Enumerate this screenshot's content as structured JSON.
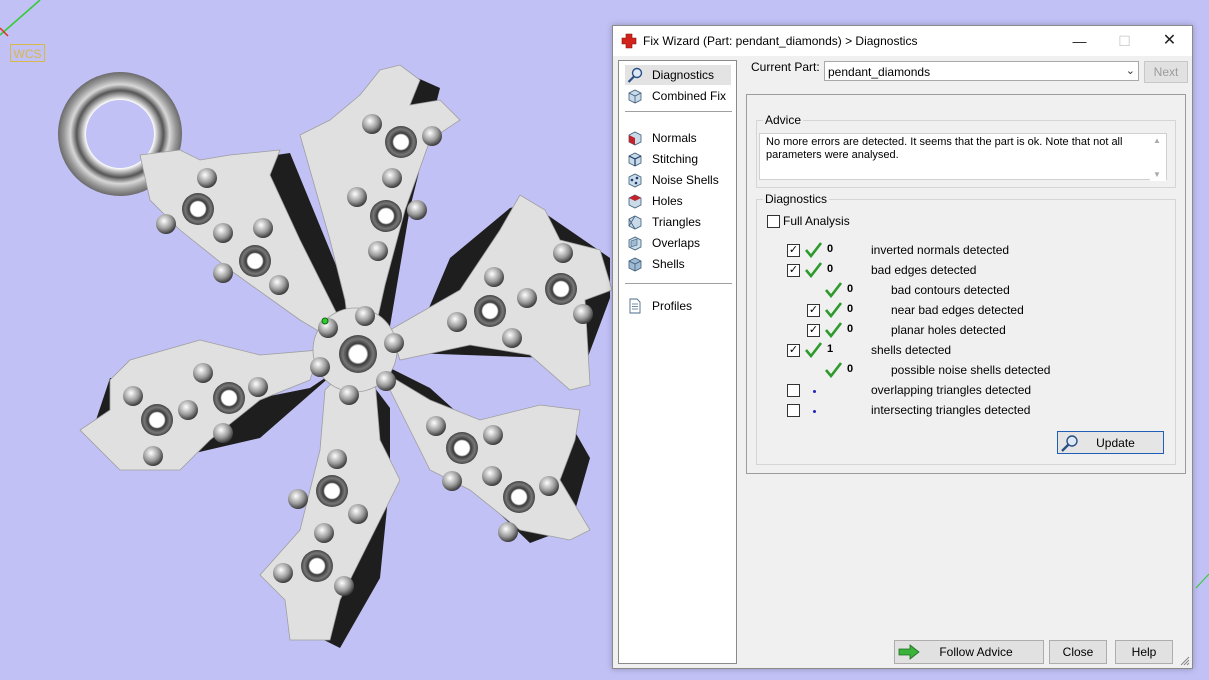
{
  "viewport": {
    "wcs_label": "WCS",
    "background_color": "#c1c1f6",
    "model_color": "#e0e0e0"
  },
  "dialog": {
    "title": "Fix Wizard (Part: pendant_diamonds) > Diagnostics",
    "title_icon": "red-cross-icon",
    "nav": {
      "items": [
        {
          "label": "Diagnostics",
          "icon": "magnifier-icon",
          "selected": true
        },
        {
          "label": "Combined Fix",
          "icon": "cube-icon"
        },
        {
          "label": "Normals",
          "icon": "normals-cube-icon"
        },
        {
          "label": "Stitching",
          "icon": "stitching-cube-icon"
        },
        {
          "label": "Noise Shells",
          "icon": "noise-shells-icon"
        },
        {
          "label": "Holes",
          "icon": "holes-cube-icon"
        },
        {
          "label": "Triangles",
          "icon": "triangles-cube-icon"
        },
        {
          "label": "Overlaps",
          "icon": "overlaps-cube-icon"
        },
        {
          "label": "Shells",
          "icon": "shells-cube-icon"
        },
        {
          "label": "Profiles",
          "icon": "document-icon"
        }
      ]
    },
    "current_part": {
      "label": "Current Part:",
      "value": "pendant_diamonds"
    },
    "next_label": "Next",
    "advice": {
      "title": "Advice",
      "text": "No more errors are detected. It seems that the part is ok. Note that not all parameters were analysed."
    },
    "diagnostics": {
      "title": "Diagnostics",
      "full_analysis_label": "Full Analysis",
      "full_analysis_checked": false,
      "rows": [
        {
          "checkbox": true,
          "checked": true,
          "status": "ok",
          "count": "0",
          "label": "inverted normals detected",
          "indent": 0
        },
        {
          "checkbox": true,
          "checked": true,
          "status": "ok",
          "count": "0",
          "label": "bad edges detected",
          "indent": 0
        },
        {
          "checkbox": false,
          "checked": false,
          "status": "ok",
          "count": "0",
          "label": "bad contours detected",
          "indent": 1
        },
        {
          "checkbox": true,
          "checked": true,
          "status": "ok",
          "count": "0",
          "label": "near bad edges detected",
          "indent": 1
        },
        {
          "checkbox": true,
          "checked": true,
          "status": "ok",
          "count": "0",
          "label": "planar holes detected",
          "indent": 1
        },
        {
          "checkbox": true,
          "checked": true,
          "status": "ok",
          "count": "1",
          "label": "shells detected",
          "indent": 0
        },
        {
          "checkbox": false,
          "checked": false,
          "status": "ok",
          "count": "0",
          "label": "possible noise shells detected",
          "indent": 1
        },
        {
          "checkbox": true,
          "checked": false,
          "status": "none",
          "count": "",
          "label": "overlapping triangles detected",
          "indent": 0
        },
        {
          "checkbox": true,
          "checked": false,
          "status": "none",
          "count": "",
          "label": "intersecting triangles detected",
          "indent": 0
        }
      ],
      "update_label": "Update"
    },
    "buttons": {
      "follow_advice": "Follow Advice",
      "close": "Close",
      "help": "Help"
    },
    "colors": {
      "check_green": "#2e9a2e",
      "accent_blue": "#1f5fb8"
    }
  }
}
